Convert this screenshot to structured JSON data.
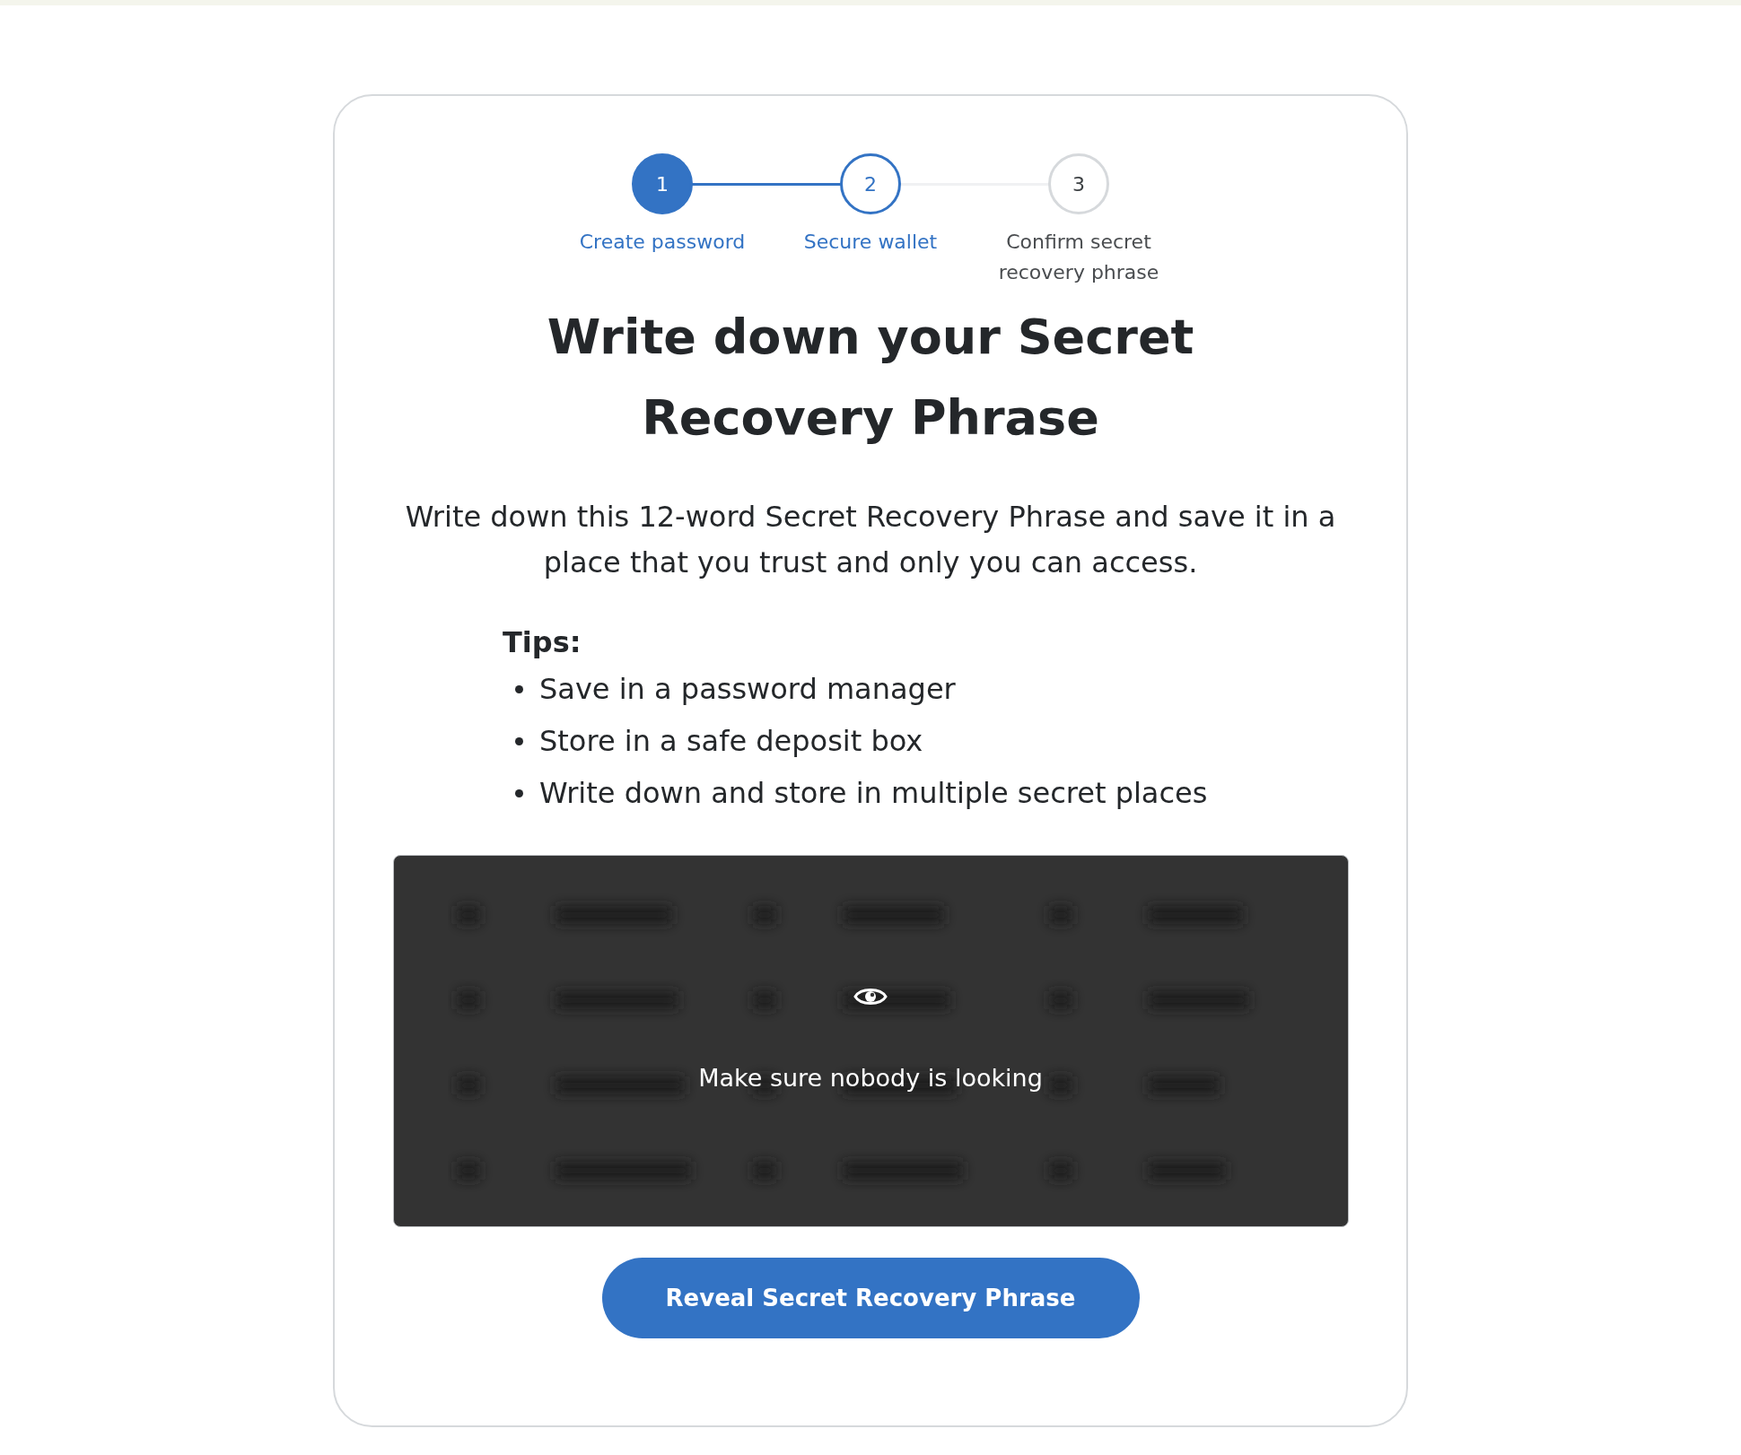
{
  "steps": [
    {
      "number": "1",
      "label": "Create password",
      "kind": "complete"
    },
    {
      "number": "2",
      "label": "Secure wallet",
      "kind": "active"
    },
    {
      "number": "3",
      "label": "Confirm secret recovery phrase",
      "kind": "upcoming"
    }
  ],
  "title": "Write down your Secret Recovery Phrase",
  "description": "Write down this 12-word Secret Recovery Phrase and save it in a place that you trust and only you can access.",
  "tips": {
    "heading": "Tips:",
    "items": [
      "Save in a password manager",
      "Store in a safe deposit box",
      "Write down and store in multiple secret places"
    ]
  },
  "phrase_box": {
    "message": "Make sure nobody is looking"
  },
  "reveal_button": "Reveal Secret Recovery Phrase"
}
